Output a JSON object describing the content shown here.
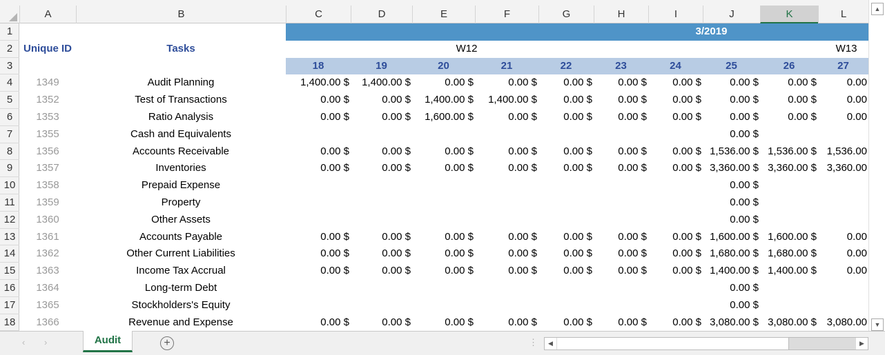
{
  "columns": [
    "A",
    "B",
    "C",
    "D",
    "E",
    "F",
    "G",
    "H",
    "I",
    "J",
    "K",
    "L"
  ],
  "selected_column": "K",
  "row_numbers": [
    "1",
    "2",
    "3",
    "4",
    "5",
    "6",
    "7",
    "8",
    "9",
    "10",
    "11",
    "12",
    "13",
    "14",
    "15",
    "16",
    "17",
    "18"
  ],
  "header": {
    "month": "3/2019",
    "unique_id": "Unique ID",
    "tasks": "Tasks",
    "week1": "W12",
    "week2": "W13",
    "days": [
      "18",
      "19",
      "20",
      "21",
      "22",
      "23",
      "24",
      "25",
      "26",
      "27"
    ]
  },
  "colors": {
    "band": "#4f94c8",
    "day_band": "#b8cce4",
    "header_text": "#2e4d9a",
    "id_text": "#999999",
    "sheet_tab": "#217346"
  },
  "rows": [
    {
      "id": "1349",
      "task": "Audit Planning",
      "values": [
        "1,400.00 $",
        "1,400.00 $",
        "0.00 $",
        "0.00 $",
        "0.00 $",
        "0.00 $",
        "0.00 $",
        "0.00 $",
        "0.00 $",
        "0.00"
      ]
    },
    {
      "id": "1352",
      "task": "Test of Transactions",
      "values": [
        "0.00 $",
        "0.00 $",
        "1,400.00 $",
        "1,400.00 $",
        "0.00 $",
        "0.00 $",
        "0.00 $",
        "0.00 $",
        "0.00 $",
        "0.00"
      ]
    },
    {
      "id": "1353",
      "task": "Ratio Analysis",
      "values": [
        "0.00 $",
        "0.00 $",
        "1,600.00 $",
        "0.00 $",
        "0.00 $",
        "0.00 $",
        "0.00 $",
        "0.00 $",
        "0.00 $",
        "0.00"
      ]
    },
    {
      "id": "1355",
      "task": "Cash and Equivalents",
      "values": [
        null,
        null,
        null,
        null,
        null,
        null,
        null,
        "0.00 $",
        null,
        null
      ]
    },
    {
      "id": "1356",
      "task": "Accounts Receivable",
      "values": [
        "0.00 $",
        "0.00 $",
        "0.00 $",
        "0.00 $",
        "0.00 $",
        "0.00 $",
        "0.00 $",
        "1,536.00 $",
        "1,536.00 $",
        "1,536.00"
      ]
    },
    {
      "id": "1357",
      "task": "Inventories",
      "values": [
        "0.00 $",
        "0.00 $",
        "0.00 $",
        "0.00 $",
        "0.00 $",
        "0.00 $",
        "0.00 $",
        "3,360.00 $",
        "3,360.00 $",
        "3,360.00"
      ]
    },
    {
      "id": "1358",
      "task": "Prepaid Expense",
      "values": [
        null,
        null,
        null,
        null,
        null,
        null,
        null,
        "0.00 $",
        null,
        null
      ]
    },
    {
      "id": "1359",
      "task": "Property",
      "values": [
        null,
        null,
        null,
        null,
        null,
        null,
        null,
        "0.00 $",
        null,
        null
      ]
    },
    {
      "id": "1360",
      "task": "Other Assets",
      "values": [
        null,
        null,
        null,
        null,
        null,
        null,
        null,
        "0.00 $",
        null,
        null
      ]
    },
    {
      "id": "1361",
      "task": "Accounts Payable",
      "values": [
        "0.00 $",
        "0.00 $",
        "0.00 $",
        "0.00 $",
        "0.00 $",
        "0.00 $",
        "0.00 $",
        "1,600.00 $",
        "1,600.00 $",
        "0.00"
      ]
    },
    {
      "id": "1362",
      "task": "Other Current Liabilities",
      "values": [
        "0.00 $",
        "0.00 $",
        "0.00 $",
        "0.00 $",
        "0.00 $",
        "0.00 $",
        "0.00 $",
        "1,680.00 $",
        "1,680.00 $",
        "0.00"
      ]
    },
    {
      "id": "1363",
      "task": "Income Tax  Accrual",
      "values": [
        "0.00 $",
        "0.00 $",
        "0.00 $",
        "0.00 $",
        "0.00 $",
        "0.00 $",
        "0.00 $",
        "1,400.00 $",
        "1,400.00 $",
        "0.00"
      ]
    },
    {
      "id": "1364",
      "task": "Long-term Debt",
      "values": [
        null,
        null,
        null,
        null,
        null,
        null,
        null,
        "0.00 $",
        null,
        null
      ]
    },
    {
      "id": "1365",
      "task": "Stockholders's Equity",
      "values": [
        null,
        null,
        null,
        null,
        null,
        null,
        null,
        "0.00 $",
        null,
        null
      ]
    },
    {
      "id": "1366",
      "task": "Revenue and Expense",
      "values": [
        "0.00 $",
        "0.00 $",
        "0.00 $",
        "0.00 $",
        "0.00 $",
        "0.00 $",
        "0.00 $",
        "3,080.00 $",
        "3,080.00 $",
        "3,080.00"
      ]
    }
  ],
  "sheet_tab": "Audit",
  "add_sheet": "+"
}
